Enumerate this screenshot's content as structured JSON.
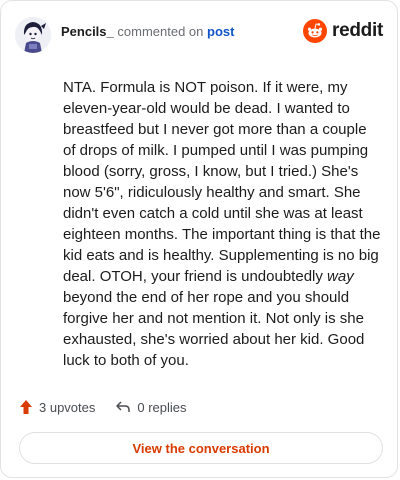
{
  "header": {
    "username": "Pencils_",
    "middle_text": "commented on",
    "post_link": "post",
    "logo_text": "reddit",
    "brand_color": "#ff4500"
  },
  "comment": {
    "part1": "NTA. Formula is NOT poison. If it were, my eleven-year-old would be dead. I wanted to breastfeed but I never got more than a couple of drops of milk. I pumped until I was pumping blood (sorry, gross, I know, but I tried.) She's now 5'6\", ridiculously healthy and smart. She didn't even catch a cold until she was at least eighteen months. The important thing is that the kid eats and is healthy. Supplementing is no big deal. OTOH, your friend is undoubtedly ",
    "emphasis": "way",
    "part2": " beyond the end of her rope and you should forgive her and not mention it. Not only is she exhausted, she's worried about her kid. Good luck to both of you."
  },
  "actions": {
    "upvotes": "3 upvotes",
    "replies": "0 replies",
    "upvote_color": "#d93a00"
  },
  "cta": {
    "label": "View the conversation"
  }
}
